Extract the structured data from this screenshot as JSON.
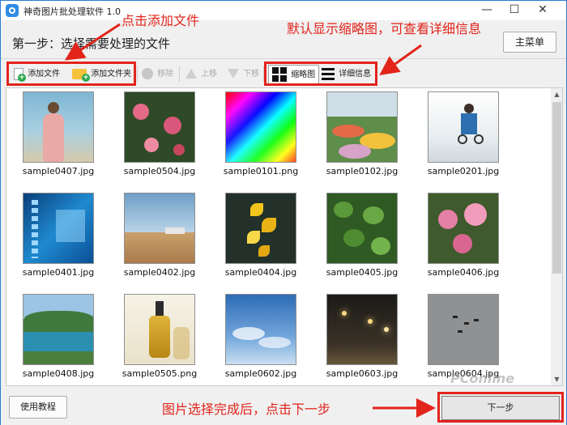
{
  "window": {
    "title": "神奇图片批处理软件 1.0",
    "controls": {
      "minimize": "—",
      "maximize": "☐",
      "close": "✕"
    }
  },
  "step": {
    "title": "第一步：选择需要处理的文件",
    "menu_button": "主菜单"
  },
  "toolbar": {
    "add_file": "添加文件",
    "add_folder": "添加文件夹",
    "remove": "移除",
    "move_up": "上移",
    "move_down": "下移",
    "view_thumbnails": "缩略图",
    "view_details": "详细信息"
  },
  "files": [
    {
      "name": "sample0407.jpg",
      "thumb": "woman-beach"
    },
    {
      "name": "sample0504.jpg",
      "thumb": "pink-blossoms"
    },
    {
      "name": "sample0101.png",
      "thumb": "color-gradient"
    },
    {
      "name": "sample0102.jpg",
      "thumb": "flower-garden"
    },
    {
      "name": "sample0201.jpg",
      "thumb": "man-bicycle"
    },
    {
      "name": "sample0401.jpg",
      "thumb": "blue-film"
    },
    {
      "name": "sample0402.jpg",
      "thumb": "field-landscape"
    },
    {
      "name": "sample0404.jpg",
      "thumb": "yellow-leaves"
    },
    {
      "name": "sample0405.jpg",
      "thumb": "green-clover"
    },
    {
      "name": "sample0406.jpg",
      "thumb": "pink-flowers"
    },
    {
      "name": "sample0408.jpg",
      "thumb": "lake-mountains"
    },
    {
      "name": "sample0505.png",
      "thumb": "perfume-bottle"
    },
    {
      "name": "sample0602.jpg",
      "thumb": "blue-sky"
    },
    {
      "name": "sample0603.jpg",
      "thumb": "night-street"
    },
    {
      "name": "sample0604.jpg",
      "thumb": "grey-birds"
    }
  ],
  "bottom": {
    "help_button": "使用教程",
    "next_button": "下一步"
  },
  "annotations": {
    "add_files": "点击添加文件",
    "view_mode": "默认显示缩略图，可查看详细信息",
    "next_step": "图片选择完成后，点击下一步"
  },
  "watermark": "PConline",
  "colors": {
    "annotation_red": "#e2241b",
    "window_border": "#2b7bd6",
    "add_icon_green": "#28a84a",
    "folder_yellow": "#f4c23b"
  }
}
